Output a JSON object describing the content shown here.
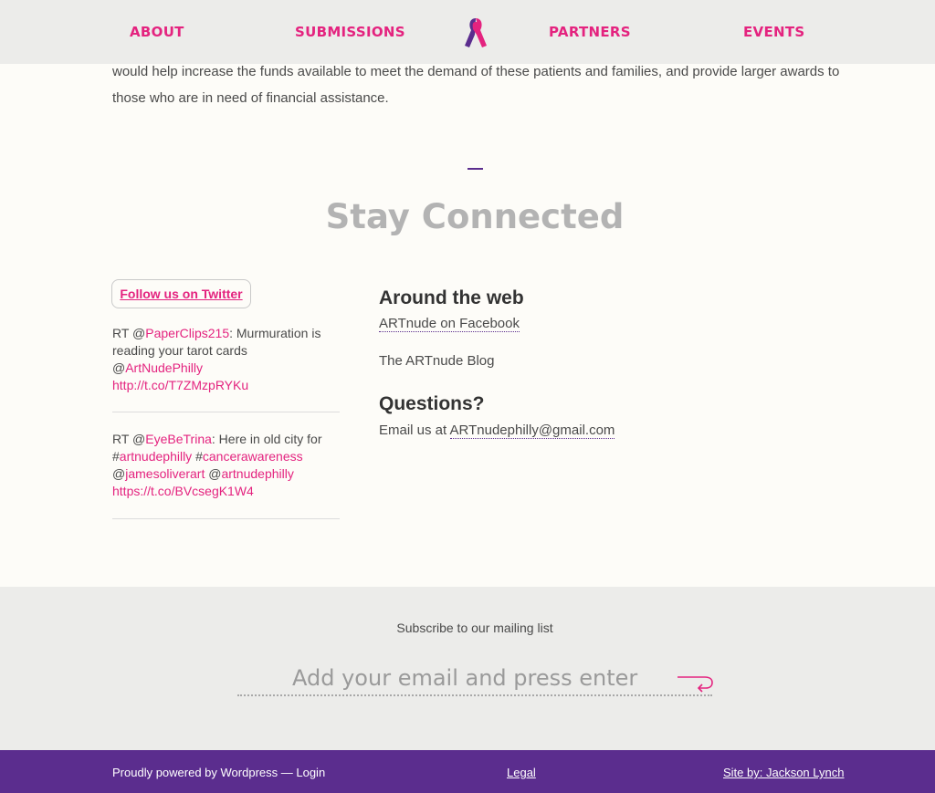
{
  "nav": {
    "about": "ABOUT",
    "submissions": "SUBMISSIONS",
    "partners": "PARTNERS",
    "events": "EVENTS",
    "logo_icon": "ribbon-icon"
  },
  "intro": {
    "text": "would help increase the funds available to meet the demand of these patients and families, and provide larger awards to those who are in need of financial assistance."
  },
  "stay_connected": {
    "title": "Stay Connected"
  },
  "twitter": {
    "follow_label": "Follow us on Twitter",
    "tweets": [
      {
        "prefix": "RT @",
        "handle": "PaperClips215",
        "text": ": Murmuration is reading your tarot cards @",
        "mention": "ArtNudePhilly",
        "link": "http://t.co/T7ZMzpRYKu"
      },
      {
        "prefix": "RT @",
        "handle": "EyeBeTrina",
        "text1": ": Here in old city for #",
        "tag1": "artnudephilly",
        "text2": " #",
        "tag2": "cancerawareness",
        "text3": " @",
        "mention1": "jamesoliverart",
        "text4": " @",
        "mention2": "artnudephilly",
        "link": "https://t.co/BVcsegK1W4"
      }
    ]
  },
  "around_web": {
    "heading": "Around the web",
    "facebook_link": "ARTnude on Facebook",
    "blog_label": "The ARTnude Blog"
  },
  "questions": {
    "heading": "Questions?",
    "email_prefix": "Email us at ",
    "email": "ARTnudephilly@gmail.com"
  },
  "subscribe": {
    "label": "Subscribe to our mailing list",
    "placeholder": "Add your email and press enter",
    "submit_icon": "return-arrow-icon"
  },
  "footer": {
    "powered": "Proudly powered by Wordpress",
    "separator": " — ",
    "login": "Login",
    "legal": "Legal",
    "site_by": "Site by: Jackson Lynch"
  },
  "colors": {
    "accent_pink": "#e4237f",
    "accent_purple": "#5b2d8e",
    "header_bg": "#ececea",
    "page_bg": "#fdfcf8"
  }
}
